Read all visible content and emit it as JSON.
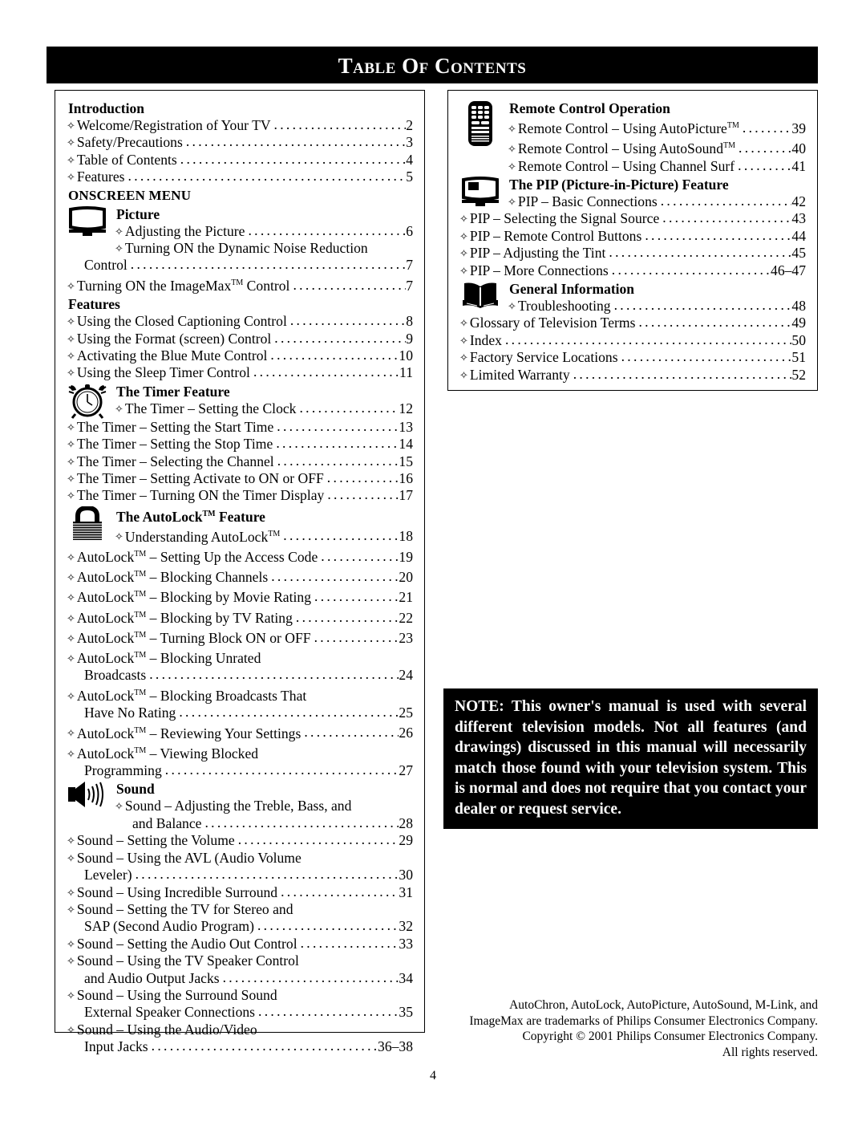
{
  "header": {
    "title": "Table of Contents"
  },
  "page_number": "4",
  "left_column": {
    "sections": [
      {
        "name": "introduction",
        "heading": "Introduction",
        "heading_style": "bold",
        "icon": null,
        "entries": [
          {
            "label": "Welcome/Registration of Your TV",
            "page": "2",
            "diamond": true
          },
          {
            "label": "Safety/Precautions",
            "page": "3",
            "diamond": true
          },
          {
            "label": "Table of Contents",
            "page": "4",
            "diamond": true
          },
          {
            "label": "Features",
            "page": "5",
            "diamond": true
          }
        ]
      },
      {
        "name": "onscreen-menu",
        "heading": "ONSCREEN MENU",
        "heading_style": "caps",
        "icon": null,
        "entries": []
      },
      {
        "name": "picture",
        "heading": "Picture",
        "heading_style": "bold",
        "icon": "tv-screen-icon",
        "entries": [
          {
            "label": "Adjusting the Picture",
            "page": "6",
            "diamond": true,
            "indent": "icon"
          },
          {
            "label": "Turning ON the Dynamic Noise Reduction",
            "page": "",
            "diamond": true,
            "indent": "icon",
            "wrap": true
          },
          {
            "label": "Control",
            "page": "7",
            "diamond": false,
            "indent": "cont"
          },
          {
            "label": "Turning ON the ImageMax™ Control",
            "page": "7",
            "diamond": true
          }
        ]
      },
      {
        "name": "features",
        "heading": "Features",
        "heading_style": "bold",
        "icon": null,
        "entries": [
          {
            "label": "Using the Closed Captioning Control",
            "page": "8",
            "diamond": true
          },
          {
            "label": "Using the Format (screen) Control",
            "page": "9",
            "diamond": true
          },
          {
            "label": "Activating the Blue Mute Control",
            "page": "10",
            "diamond": true
          },
          {
            "label": "Using the Sleep Timer Control",
            "page": "11",
            "diamond": true
          }
        ]
      },
      {
        "name": "timer-feature",
        "heading": "The Timer Feature",
        "heading_style": "bold",
        "icon": "alarm-clock-icon",
        "entries": [
          {
            "label": "The Timer – Setting the Clock",
            "page": "12",
            "diamond": true,
            "indent": "icon"
          },
          {
            "label": "The Timer – Setting the Start Time",
            "page": "13",
            "diamond": true
          },
          {
            "label": "The Timer – Setting the Stop Time",
            "page": "14",
            "diamond": true
          },
          {
            "label": "The Timer – Selecting the Channel",
            "page": "15",
            "diamond": true
          },
          {
            "label": "The Timer – Setting Activate to ON or OFF",
            "page": "16",
            "diamond": true
          },
          {
            "label": "The Timer – Turning ON the Timer Display",
            "page": "17",
            "diamond": true
          }
        ]
      },
      {
        "name": "autolock-feature",
        "heading": "The AutoLock™ Feature",
        "heading_style": "bold",
        "icon": "padlock-icon",
        "entries": [
          {
            "label": "Understanding AutoLock™",
            "page": "18",
            "diamond": true,
            "indent": "icon"
          },
          {
            "label": "AutoLock™ – Setting Up the Access Code",
            "page": "19",
            "diamond": true
          },
          {
            "label": "AutoLock™ – Blocking Channels",
            "page": "20",
            "diamond": true
          },
          {
            "label": "AutoLock™ – Blocking by Movie Rating",
            "page": "21",
            "diamond": true
          },
          {
            "label": "AutoLock™ – Blocking by TV Rating",
            "page": "22",
            "diamond": true
          },
          {
            "label": "AutoLock™ – Turning Block ON or OFF",
            "page": "23",
            "diamond": true
          },
          {
            "label": "AutoLock™ – Blocking Unrated",
            "page": "",
            "diamond": true,
            "wrap": true
          },
          {
            "label": "Broadcasts",
            "page": "24",
            "diamond": false,
            "indent": "cont"
          },
          {
            "label": "AutoLock™ – Blocking Broadcasts That",
            "page": "",
            "diamond": true,
            "wrap": true
          },
          {
            "label": "Have No Rating",
            "page": "25",
            "diamond": false,
            "indent": "cont"
          },
          {
            "label": "AutoLock™ – Reviewing Your Settings",
            "page": "26",
            "diamond": true
          },
          {
            "label": "AutoLock™ – Viewing Blocked",
            "page": "",
            "diamond": true,
            "wrap": true
          },
          {
            "label": "Programming",
            "page": "27",
            "diamond": false,
            "indent": "cont"
          }
        ]
      },
      {
        "name": "sound",
        "heading": "Sound",
        "heading_style": "bold",
        "icon": "speaker-icon",
        "entries": [
          {
            "label": "Sound – Adjusting the Treble, Bass, and",
            "page": "",
            "diamond": true,
            "indent": "icon",
            "wrap": true
          },
          {
            "label": "and Balance",
            "page": "28",
            "diamond": false,
            "indent": "cont"
          },
          {
            "label": "Sound – Setting the Volume",
            "page": "29",
            "diamond": true
          },
          {
            "label": "Sound – Using the AVL (Audio Volume",
            "page": "",
            "diamond": true,
            "wrap": true
          },
          {
            "label": "Leveler)",
            "page": "30",
            "diamond": false,
            "indent": "cont"
          },
          {
            "label": "Sound – Using Incredible Surround",
            "page": "31",
            "diamond": true
          },
          {
            "label": "Sound – Setting the TV for Stereo and",
            "page": "",
            "diamond": true,
            "wrap": true
          },
          {
            "label": "SAP (Second Audio Program)",
            "page": "32",
            "diamond": false,
            "indent": "cont"
          },
          {
            "label": "Sound – Setting the Audio Out Control",
            "page": "33",
            "diamond": true
          },
          {
            "label": "Sound – Using the TV Speaker Control",
            "page": "",
            "diamond": true,
            "wrap": true
          },
          {
            "label": "and Audio Output Jacks",
            "page": "34",
            "diamond": false,
            "indent": "cont"
          },
          {
            "label": "Sound – Using the Surround Sound",
            "page": "",
            "diamond": true,
            "wrap": true
          },
          {
            "label": "External Speaker Connections",
            "page": "35",
            "diamond": false,
            "indent": "cont"
          },
          {
            "label": "Sound – Using the Audio/Video",
            "page": "",
            "diamond": true,
            "wrap": true
          },
          {
            "label": "Input Jacks",
            "page": "36–38",
            "diamond": false,
            "indent": "cont"
          }
        ]
      }
    ]
  },
  "right_column": {
    "sections": [
      {
        "name": "remote-control-operation",
        "heading": "Remote Control Operation",
        "heading_style": "bold",
        "icon": "remote-control-icon",
        "entries": [
          {
            "label": "Remote Control – Using AutoPicture™",
            "page": "39",
            "diamond": true,
            "indent": "icon"
          },
          {
            "label": "Remote Control – Using AutoSound™",
            "page": "40",
            "diamond": true,
            "indent": "icon"
          },
          {
            "label": "Remote Control – Using Channel Surf",
            "page": "41",
            "diamond": true,
            "indent": "icon2"
          }
        ]
      },
      {
        "name": "pip-feature",
        "heading": "The PIP (Picture-in-Picture) Feature",
        "heading_style": "bold",
        "icon": "pip-tv-icon",
        "entries": [
          {
            "label": "PIP – Basic Connections",
            "page": "42",
            "diamond": true,
            "indent": "icon"
          },
          {
            "label": "PIP – Selecting the Signal Source",
            "page": "43",
            "diamond": true
          },
          {
            "label": "PIP – Remote Control Buttons",
            "page": "44",
            "diamond": true
          },
          {
            "label": "PIP – Adjusting the Tint",
            "page": "45",
            "diamond": true
          },
          {
            "label": "PIP – More Connections",
            "page": "46–47",
            "diamond": true
          }
        ]
      },
      {
        "name": "general-information",
        "heading": "General Information",
        "heading_style": "bold",
        "icon": "open-book-icon",
        "entries": [
          {
            "label": "Troubleshooting",
            "page": "48",
            "diamond": true,
            "indent": "icon"
          },
          {
            "label": "Glossary of Television Terms",
            "page": "49",
            "diamond": true
          },
          {
            "label": "Index",
            "page": "50",
            "diamond": true
          },
          {
            "label": "Factory Service Locations",
            "page": "51",
            "diamond": true
          },
          {
            "label": "Limited Warranty",
            "page": "52",
            "diamond": true
          }
        ]
      }
    ]
  },
  "note_box": {
    "text": "NOTE: This owner's manual is used with several different television models.  Not all features (and  drawings) discussed in this manual will necessarily match those found with your television system. This is normal and does not require that you contact your dealer or request service."
  },
  "footer": {
    "lines": [
      "AutoChron, AutoLock, AutoPicture, AutoSound, M-Link, and",
      "ImageMax are trademarks of Philips Consumer Electronics Company.",
      "Copyright © 2001 Philips Consumer Electronics Company.",
      "All rights reserved."
    ]
  },
  "colors": {
    "ink": "#000000",
    "paper": "#ffffff",
    "banner_bg": "#000000",
    "banner_fg": "#ffffff"
  }
}
